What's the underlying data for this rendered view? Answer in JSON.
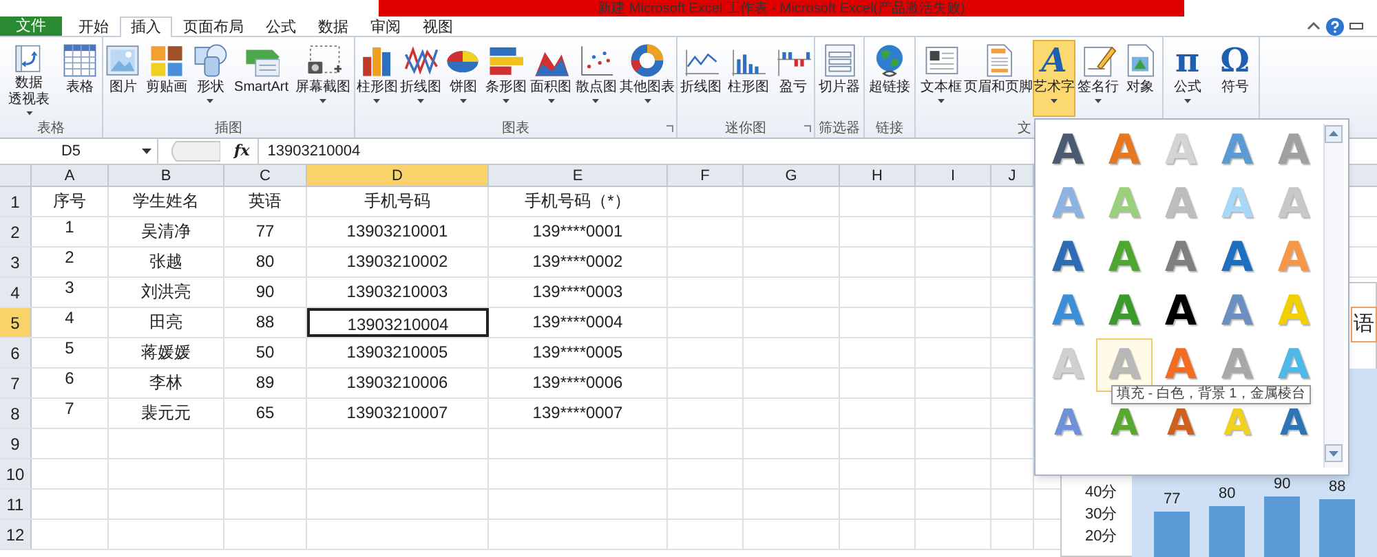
{
  "window": {
    "title": "新建 Microsoft Excel 工作表 - Microsoft Excel(产品激活失败)"
  },
  "tabs": [
    {
      "label": "文件",
      "kind": "file",
      "selected": false
    },
    {
      "label": "开始",
      "kind": "tab",
      "selected": false
    },
    {
      "label": "插入",
      "kind": "tab",
      "selected": true
    },
    {
      "label": "页面布局",
      "kind": "tab",
      "selected": false
    },
    {
      "label": "公式",
      "kind": "tab",
      "selected": false
    },
    {
      "label": "数据",
      "kind": "tab",
      "selected": false
    },
    {
      "label": "审阅",
      "kind": "tab",
      "selected": false
    },
    {
      "label": "视图",
      "kind": "tab",
      "selected": false
    }
  ],
  "ribbon": {
    "groups": [
      {
        "label": "表格",
        "buttons": [
          {
            "label_lines": [
              "数据",
              "透视表"
            ],
            "dropdown": true,
            "selected": false
          },
          {
            "label": "表格",
            "dropdown": false,
            "selected": false
          }
        ]
      },
      {
        "label": "插图",
        "buttons": [
          {
            "label": "图片",
            "dropdown": false,
            "selected": false
          },
          {
            "label": "剪贴画",
            "dropdown": false,
            "selected": false
          },
          {
            "label": "形状",
            "dropdown": true,
            "selected": false
          },
          {
            "label": "SmartArt",
            "dropdown": false,
            "selected": false
          },
          {
            "label": "屏幕截图",
            "dropdown": true,
            "selected": false
          }
        ]
      },
      {
        "label": "图表",
        "launcher": true,
        "buttons": [
          {
            "label": "柱形图",
            "dropdown": true,
            "selected": false
          },
          {
            "label": "折线图",
            "dropdown": true,
            "selected": false
          },
          {
            "label": "饼图",
            "dropdown": true,
            "selected": false
          },
          {
            "label": "条形图",
            "dropdown": true,
            "selected": false
          },
          {
            "label": "面积图",
            "dropdown": true,
            "selected": false
          },
          {
            "label": "散点图",
            "dropdown": true,
            "selected": false
          },
          {
            "label": "其他图表",
            "dropdown": true,
            "selected": false
          }
        ]
      },
      {
        "label": "迷你图",
        "launcher": true,
        "buttons": [
          {
            "label": "折线图",
            "dropdown": false,
            "selected": false
          },
          {
            "label": "柱形图",
            "dropdown": false,
            "selected": false
          },
          {
            "label": "盈亏",
            "dropdown": false,
            "selected": false
          }
        ]
      },
      {
        "label": "筛选器",
        "buttons": [
          {
            "label": "切片器",
            "dropdown": false,
            "selected": false
          }
        ]
      },
      {
        "label": "链接",
        "buttons": [
          {
            "label": "超链接",
            "dropdown": false,
            "selected": false
          }
        ]
      },
      {
        "label": "文",
        "buttons": [
          {
            "label": "文本框",
            "dropdown": true,
            "selected": false
          },
          {
            "label": "页眉和页脚",
            "dropdown": false,
            "selected": false
          },
          {
            "label": "艺术字",
            "glyph": "A",
            "dropdown": true,
            "selected": true
          },
          {
            "label": "签名行",
            "dropdown": true,
            "selected": false
          },
          {
            "label": "对象",
            "dropdown": false,
            "selected": false
          }
        ]
      },
      {
        "buttons": [
          {
            "label": "公式",
            "glyph": "π",
            "dropdown": true,
            "selected": false
          },
          {
            "label": "符号",
            "glyph": "Ω",
            "dropdown": false,
            "selected": false
          }
        ]
      }
    ]
  },
  "formula_bar": {
    "name_box": "D5",
    "function_button": "fx",
    "value": "13903210004"
  },
  "sheet": {
    "columns": [
      {
        "label": "A",
        "selected": false
      },
      {
        "label": "B",
        "selected": false
      },
      {
        "label": "C",
        "selected": false
      },
      {
        "label": "D",
        "selected": true
      },
      {
        "label": "E",
        "selected": false
      },
      {
        "label": "F",
        "selected": false
      },
      {
        "label": "G",
        "selected": false
      },
      {
        "label": "H",
        "selected": false
      },
      {
        "label": "I",
        "selected": false
      },
      {
        "label": "J",
        "selected": false
      }
    ],
    "row_numbers": [
      {
        "label": "1",
        "selected": false
      },
      {
        "label": "2",
        "selected": false
      },
      {
        "label": "3",
        "selected": false
      },
      {
        "label": "4",
        "selected": false
      },
      {
        "label": "5",
        "selected": true
      },
      {
        "label": "6",
        "selected": false
      },
      {
        "label": "7",
        "selected": false
      },
      {
        "label": "8",
        "selected": false
      },
      {
        "label": "9",
        "selected": false
      },
      {
        "label": "10",
        "selected": false
      },
      {
        "label": "11",
        "selected": false
      },
      {
        "label": "12",
        "selected": false
      }
    ],
    "rows": [
      [
        "序号",
        "学生姓名",
        "英语",
        "手机号码",
        "手机号码（*）"
      ],
      [
        "1",
        "吴清净",
        "77",
        "13903210001",
        "139****0001"
      ],
      [
        "2",
        "张越",
        "80",
        "13903210002",
        "139****0002"
      ],
      [
        "3",
        "刘洪亮",
        "90",
        "13903210003",
        "139****0003"
      ],
      [
        "4",
        "田亮",
        "88",
        "13903210004",
        "139****0004"
      ],
      [
        "5",
        "蒋媛媛",
        "50",
        "13903210005",
        "139****0005"
      ],
      [
        "6",
        "李林",
        "89",
        "13903210006",
        "139****0006"
      ],
      [
        "7",
        "裴元元",
        "65",
        "13903210007",
        "139****0007"
      ]
    ]
  },
  "chart": {
    "title_fragment": "语",
    "axis_labels": [
      "40分",
      "30分",
      "20分"
    ],
    "value_labels": [
      "77",
      "80",
      "90",
      "88"
    ]
  },
  "wordart_gallery": {
    "items": [
      {
        "glyph": "A",
        "color": "#4a5a70",
        "hovered": false
      },
      {
        "glyph": "A",
        "color": "#e87722",
        "hovered": false
      },
      {
        "glyph": "A",
        "color": "#d4d4d4",
        "hovered": false
      },
      {
        "glyph": "A",
        "color": "#5b9bd5",
        "hovered": false
      },
      {
        "glyph": "A",
        "color": "#a0a0a0",
        "hovered": false
      },
      {
        "glyph": "A",
        "color": "#8db3e2",
        "hovered": false
      },
      {
        "glyph": "A",
        "color": "#9bd07a",
        "hovered": false
      },
      {
        "glyph": "A",
        "color": "#bdbdbd",
        "hovered": false
      },
      {
        "glyph": "A",
        "color": "#a8d8f8",
        "hovered": false
      },
      {
        "glyph": "A",
        "color": "#c8c8c8",
        "hovered": false
      },
      {
        "glyph": "A",
        "color": "#2e6db4",
        "hovered": false
      },
      {
        "glyph": "A",
        "color": "#4ea72e",
        "hovered": false
      },
      {
        "glyph": "A",
        "color": "#7f7f7f",
        "hovered": false
      },
      {
        "glyph": "A",
        "color": "#1f6fc0",
        "hovered": false
      },
      {
        "glyph": "A",
        "color": "#f79646",
        "hovered": false
      },
      {
        "glyph": "A",
        "color": "#3d8ed8",
        "hovered": false
      },
      {
        "glyph": "A",
        "color": "#3a9a2a",
        "hovered": false
      },
      {
        "glyph": "A",
        "color": "#000000",
        "hovered": false
      },
      {
        "glyph": "A",
        "color": "#6a8fc0",
        "hovered": false
      },
      {
        "glyph": "A",
        "color": "#f2d000",
        "hovered": false
      },
      {
        "glyph": "A",
        "color": "#d0d0d0",
        "hovered": false
      },
      {
        "glyph": "A",
        "color": "#b8b8b8",
        "hovered": true
      },
      {
        "glyph": "A",
        "color": "#f26d21",
        "hovered": false
      },
      {
        "glyph": "A",
        "color": "#a8a8a8",
        "hovered": false
      },
      {
        "glyph": "A",
        "color": "#4fb8e8",
        "hovered": false
      },
      {
        "glyph": "A",
        "color": "#7090d8",
        "hovered": false
      },
      {
        "glyph": "A",
        "color": "#5aa832",
        "hovered": false
      },
      {
        "glyph": "A",
        "color": "#d06020",
        "hovered": false
      },
      {
        "glyph": "A",
        "color": "#f0d020",
        "hovered": false
      },
      {
        "glyph": "A",
        "color": "#2e75b6",
        "hovered": false
      }
    ],
    "tooltip": "填充 - 白色，背景 1，金属棱台"
  }
}
